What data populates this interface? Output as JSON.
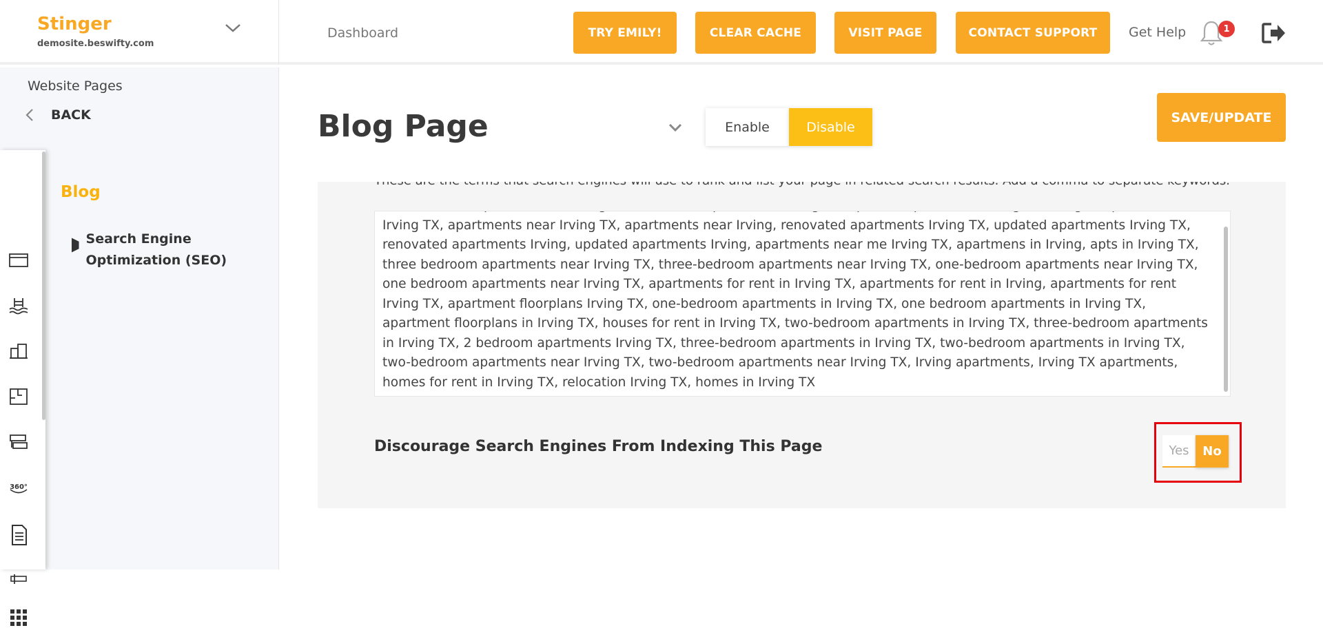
{
  "brand": {
    "name": "Stinger",
    "domain": "demosite.beswifty.com"
  },
  "header": {
    "nav_dashboard": "Dashboard",
    "buttons": {
      "try_emily": "TRY EMILY!",
      "clear_cache": "CLEAR CACHE",
      "visit_page": "VISIT PAGE",
      "contact_support": "CONTACT SUPPORT"
    },
    "get_help": "Get Help",
    "notification_count": "1",
    "accent_color": "#f9a825",
    "badge_color": "#e53935"
  },
  "sidebar": {
    "section_title": "Website Pages",
    "back_label": "BACK",
    "current_page": "Blog",
    "current_subsection": "Search Engine Optimization (SEO)",
    "rail_icons": [
      "browser-window-icon",
      "pool-icon",
      "buildings-icon",
      "floorplan-icon",
      "cards-icon",
      "view-360-icon",
      "document-icon",
      "sign-icon",
      "grid-icon"
    ]
  },
  "main": {
    "page_title": "Blog Page",
    "toggle": {
      "enable_label": "Enable",
      "disable_label": "Disable",
      "selected": "Disable"
    },
    "save_label": "SAVE/UPDATE",
    "seo": {
      "help_text": "These are the terms that search engines will use to rank and list your page in related search results. Add a comma to separate keywords.",
      "keywords_value": "new luxurious apartments in Irving TX, renovated apartments Irving TX, updated apartments Irving TX, Stinger, apartments in Irving TX, apartments near Irving TX, apartments near Irving, renovated apartments Irving TX, updated apartments Irving TX, renovated apartments Irving, updated apartments Irving, apartments near me Irving TX, apartmens in Irving, apts in Irving TX, three bedroom apartments near Irving TX, three-bedroom apartments near Irving TX, one-bedroom apartments near Irving TX, one bedroom apartments near Irving TX, apartments for rent in Irving TX, apartments for rent in Irving, apartments for rent Irving TX, apartment floorplans Irving TX, one-bedroom apartments in Irving TX, one bedroom apartments in Irving TX, apartment floorplans in Irving TX, houses for rent in Irving TX, two-bedroom apartments in Irving TX, three-bedroom apartments in Irving TX, 2 bedroom apartments Irving TX, three-bedroom apartments in Irving TX, two-bedroom apartments in Irving TX, two-bedroom apartments near Irving TX, two-bedroom apartments near Irving TX, Irving apartments, Irving TX apartments, homes for rent in Irving TX, relocation Irving TX, homes in Irving TX",
      "discourage_label": "Discourage Search Engines From Indexing This Page",
      "yes_label": "Yes",
      "no_label": "No",
      "selected": "No"
    }
  }
}
